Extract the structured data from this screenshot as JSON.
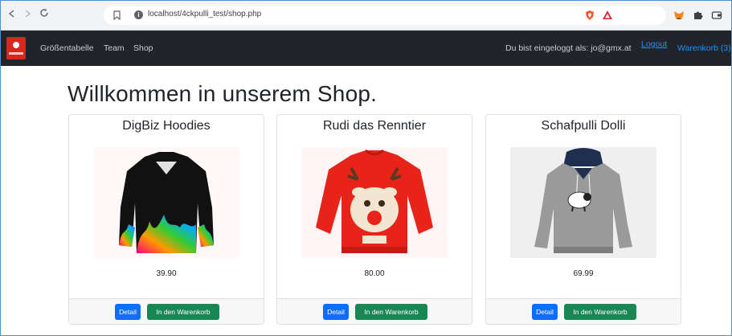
{
  "browser": {
    "url": "localhost/4ckpulli_test/shop.php"
  },
  "navbar": {
    "links": [
      "Größentabelle",
      "Team",
      "Shop"
    ],
    "logged_in_text": "Du bist eingeloggt als: jo@gmx.at",
    "logout_label": "Logout",
    "cart_label": "Warenkorb (3)"
  },
  "main": {
    "title": "Willkommen in unserem Shop."
  },
  "products": [
    {
      "name": "DigBiz Hoodies",
      "price": "39.90",
      "detail_label": "Detail",
      "cart_label": "In den Warenkorb"
    },
    {
      "name": "Rudi das Renntier",
      "price": "80.00",
      "detail_label": "Detail",
      "cart_label": "In den Warenkorb"
    },
    {
      "name": "Schafpulli Dolli",
      "price": "69.99",
      "detail_label": "Detail",
      "cart_label": "In den Warenkorb"
    }
  ],
  "colors": {
    "navbar_bg": "#212529",
    "primary": "#0d6efd",
    "success": "#198754",
    "link": "#1e90ff",
    "brand": "#d9261c"
  },
  "icons": {
    "back": "back-arrow-icon",
    "forward": "forward-arrow-icon",
    "reload": "reload-icon",
    "bookmark": "bookmark-icon",
    "site_info": "info-icon",
    "brave": "brave-shield-icon",
    "rewards": "brave-rewards-icon",
    "metamask": "metamask-fox-icon",
    "extensions": "puzzle-icon",
    "wallet": "wallet-icon"
  }
}
